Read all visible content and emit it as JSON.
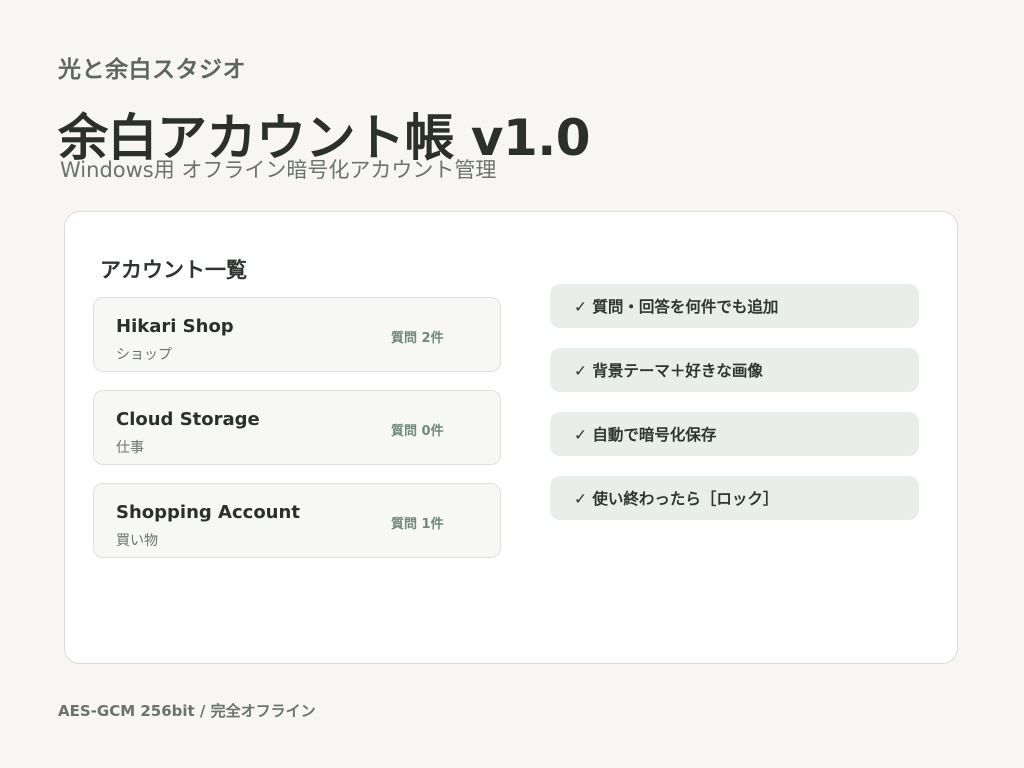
{
  "header": {
    "studio": "光と余白スタジオ",
    "title": "余白アカウント帳 v1.0",
    "subtitle": "Windows用 オフライン暗号化アカウント管理"
  },
  "panel": {
    "section_title": "アカウント一覧",
    "accounts": [
      {
        "name": "Hikari Shop",
        "category": "ショップ",
        "count": "質問 2件"
      },
      {
        "name": "Cloud Storage",
        "category": "仕事",
        "count": "質問 0件"
      },
      {
        "name": "Shopping Account",
        "category": "買い物",
        "count": "質問 1件"
      }
    ],
    "features": [
      "✓ 質問・回答を何件でも追加",
      "✓ 背景テーマ＋好きな画像",
      "✓ 自動で暗号化保存",
      "✓ 使い終わったら［ロック］"
    ]
  },
  "footer": {
    "text": "AES-GCM 256bit / 完全オフライン"
  },
  "colors": {
    "background": "#f7f6f3",
    "panel": "#ffffff",
    "card": "#f7f7f5",
    "feature_pill": "#e9eeea",
    "accent_green": "#6f8a78",
    "text_dark": "#2b302c",
    "text_muted": "#6b736d"
  }
}
